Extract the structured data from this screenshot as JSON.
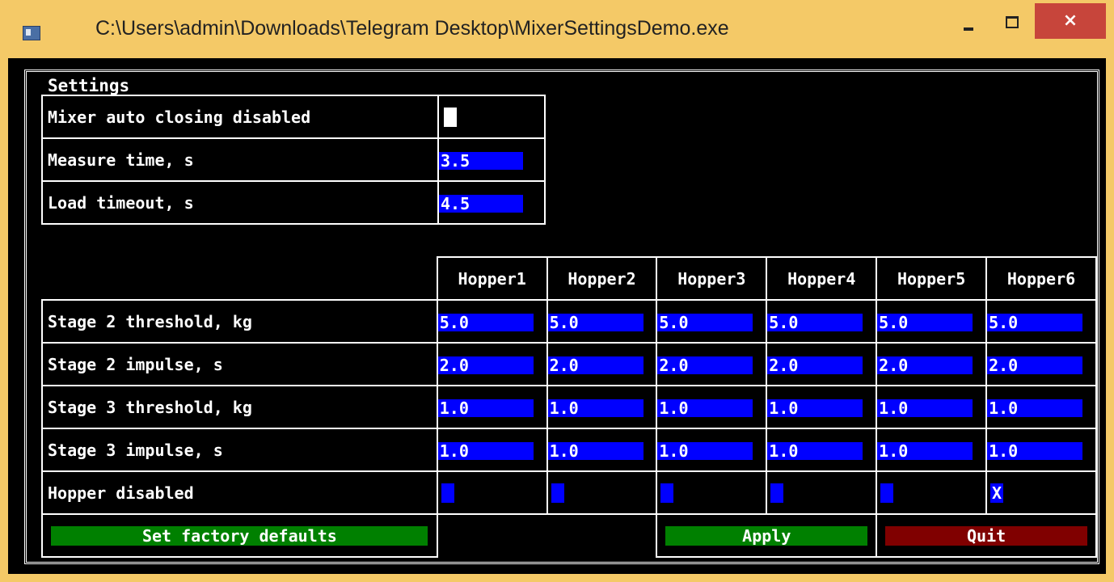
{
  "window": {
    "title": "C:\\Users\\admin\\Downloads\\Telegram Desktop\\MixerSettingsDemo.exe",
    "close_label": "×"
  },
  "settings": {
    "legend": "Settings",
    "general": [
      {
        "label": "Mixer auto closing disabled",
        "type": "checkbox",
        "checked": false
      },
      {
        "label": "Measure time, s",
        "type": "number",
        "value": "3.5"
      },
      {
        "label": "Load timeout, s",
        "type": "number",
        "value": "4.5"
      }
    ],
    "hoppers": {
      "columns": [
        "Hopper1",
        "Hopper2",
        "Hopper3",
        "Hopper4",
        "Hopper5",
        "Hopper6"
      ],
      "rows": [
        {
          "label": "Stage 2 threshold, kg",
          "values": [
            "5.0",
            "5.0",
            "5.0",
            "5.0",
            "5.0",
            "5.0"
          ]
        },
        {
          "label": "Stage 2 impulse, s",
          "values": [
            "2.0",
            "2.0",
            "2.0",
            "2.0",
            "2.0",
            "2.0"
          ]
        },
        {
          "label": "Stage 3 threshold, kg",
          "values": [
            "1.0",
            "1.0",
            "1.0",
            "1.0",
            "1.0",
            "1.0"
          ]
        },
        {
          "label": "Stage 3 impulse, s",
          "values": [
            "1.0",
            "1.0",
            "1.0",
            "1.0",
            "1.0",
            "1.0"
          ]
        }
      ],
      "disabled_label": "Hopper disabled",
      "disabled": [
        "",
        "",
        "",
        "",
        "",
        "X"
      ]
    },
    "buttons": {
      "factory": "Set factory defaults",
      "apply": "Apply",
      "quit": "Quit"
    },
    "colors": {
      "field_bg": "#0000ff",
      "button_green": "#008000",
      "button_red": "#800000",
      "frame_accent": "#f4c967"
    }
  }
}
